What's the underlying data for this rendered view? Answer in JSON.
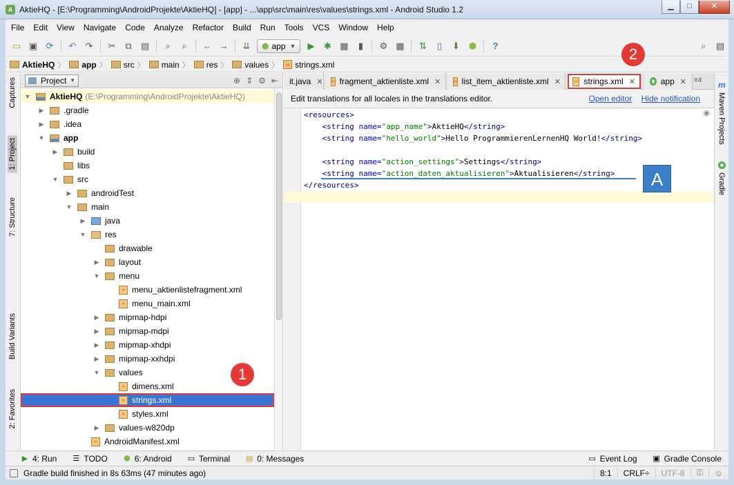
{
  "window": {
    "title": "AktieHQ - [E:\\Programming\\AndroidProjekte\\AktieHQ] - [app] - ...\\app\\src\\main\\res\\values\\strings.xml - Android Studio 1.2",
    "app_icon": "android-studio-icon"
  },
  "menu": [
    "File",
    "Edit",
    "View",
    "Navigate",
    "Code",
    "Analyze",
    "Refactor",
    "Build",
    "Run",
    "Tools",
    "VCS",
    "Window",
    "Help"
  ],
  "toolbar": {
    "run_config": "app"
  },
  "breadcrumb": [
    "AktieHQ",
    "app",
    "src",
    "main",
    "res",
    "values",
    "strings.xml"
  ],
  "left_strip": [
    "Captures",
    "1: Project",
    "7: Structure",
    "Build Variants",
    "2: Favorites"
  ],
  "right_strip": [
    "Maven Projects",
    "Gradle"
  ],
  "project_panel": {
    "selector": "Project",
    "tree": [
      {
        "label": "AktieHQ",
        "extra": "(E:\\Programming\\AndroidProjekte\\AktieHQ)",
        "depth": 0,
        "arrow": "down",
        "icon": "module"
      },
      {
        "label": ".gradle",
        "depth": 1,
        "arrow": "right",
        "icon": "folder"
      },
      {
        "label": ".idea",
        "depth": 1,
        "arrow": "right",
        "icon": "folder"
      },
      {
        "label": "app",
        "depth": 1,
        "arrow": "down",
        "icon": "module"
      },
      {
        "label": "build",
        "depth": 2,
        "arrow": "right",
        "icon": "folder"
      },
      {
        "label": "libs",
        "depth": 2,
        "arrow": "",
        "icon": "folder"
      },
      {
        "label": "src",
        "depth": 2,
        "arrow": "down",
        "icon": "folder"
      },
      {
        "label": "androidTest",
        "depth": 3,
        "arrow": "right",
        "icon": "folder"
      },
      {
        "label": "main",
        "depth": 3,
        "arrow": "down",
        "icon": "folder"
      },
      {
        "label": "java",
        "depth": 4,
        "arrow": "right",
        "icon": "src"
      },
      {
        "label": "res",
        "depth": 4,
        "arrow": "down",
        "icon": "res"
      },
      {
        "label": "drawable",
        "depth": 5,
        "arrow": "",
        "icon": "folder"
      },
      {
        "label": "layout",
        "depth": 5,
        "arrow": "right",
        "icon": "folder"
      },
      {
        "label": "menu",
        "depth": 5,
        "arrow": "down",
        "icon": "folder"
      },
      {
        "label": "menu_aktienlistefragment.xml",
        "depth": 6,
        "arrow": "",
        "icon": "xml"
      },
      {
        "label": "menu_main.xml",
        "depth": 6,
        "arrow": "",
        "icon": "xml"
      },
      {
        "label": "mipmap-hdpi",
        "depth": 5,
        "arrow": "right",
        "icon": "folder"
      },
      {
        "label": "mipmap-mdpi",
        "depth": 5,
        "arrow": "right",
        "icon": "folder"
      },
      {
        "label": "mipmap-xhdpi",
        "depth": 5,
        "arrow": "right",
        "icon": "folder"
      },
      {
        "label": "mipmap-xxhdpi",
        "depth": 5,
        "arrow": "right",
        "icon": "folder"
      },
      {
        "label": "values",
        "depth": 5,
        "arrow": "down",
        "icon": "folder"
      },
      {
        "label": "dimens.xml",
        "depth": 6,
        "arrow": "",
        "icon": "xml"
      },
      {
        "label": "strings.xml",
        "depth": 6,
        "arrow": "",
        "icon": "xml",
        "selected": true
      },
      {
        "label": "styles.xml",
        "depth": 6,
        "arrow": "",
        "icon": "xml"
      },
      {
        "label": "values-w820dp",
        "depth": 5,
        "arrow": "right",
        "icon": "folder"
      },
      {
        "label": "AndroidManifest.xml",
        "depth": 4,
        "arrow": "",
        "icon": "xml"
      }
    ]
  },
  "editor_tabs": [
    {
      "label": "it.java",
      "icon": "",
      "active": false
    },
    {
      "label": "fragment_aktienliste.xml",
      "icon": "xml",
      "active": false
    },
    {
      "label": "list_item_aktienliste.xml",
      "icon": "xml",
      "active": false
    },
    {
      "label": "strings.xml",
      "icon": "xml",
      "active": true
    },
    {
      "label": "app",
      "icon": "app",
      "active": false
    }
  ],
  "tabs_overflow": "≡4",
  "notification": {
    "text": "Edit translations for all locales in the translations editor.",
    "open_editor": "Open editor",
    "hide": "Hide notification"
  },
  "code_lines": [
    {
      "kind": "open",
      "text": "<resources>"
    },
    {
      "kind": "string",
      "name": "app_name",
      "value": "AktieHQ"
    },
    {
      "kind": "string",
      "name": "hello_world",
      "value": "Hello ProgrammierenLernenHQ World!"
    },
    {
      "kind": "blank"
    },
    {
      "kind": "string",
      "name": "action_settings",
      "value": "Settings"
    },
    {
      "kind": "string",
      "name": "action_daten_aktualisieren",
      "value": "Aktualisieren"
    },
    {
      "kind": "close",
      "text": "</resources>"
    }
  ],
  "annotations": {
    "marker1": "1",
    "marker2": "2",
    "markerA": "A"
  },
  "bottom_tools": {
    "left": [
      "4: Run",
      "TODO",
      "6: Android",
      "Terminal",
      "0: Messages"
    ],
    "right": [
      "Event Log",
      "Gradle Console"
    ]
  },
  "status": {
    "message": "Gradle build finished in 8s 63ms (47 minutes ago)",
    "position": "8:1",
    "line_sep": "CRLF÷",
    "encoding": "UTF-8"
  },
  "colors": {
    "accent_red": "#e53935",
    "annotation_blue": "#3b7ec8",
    "selection": "#3875d7"
  }
}
